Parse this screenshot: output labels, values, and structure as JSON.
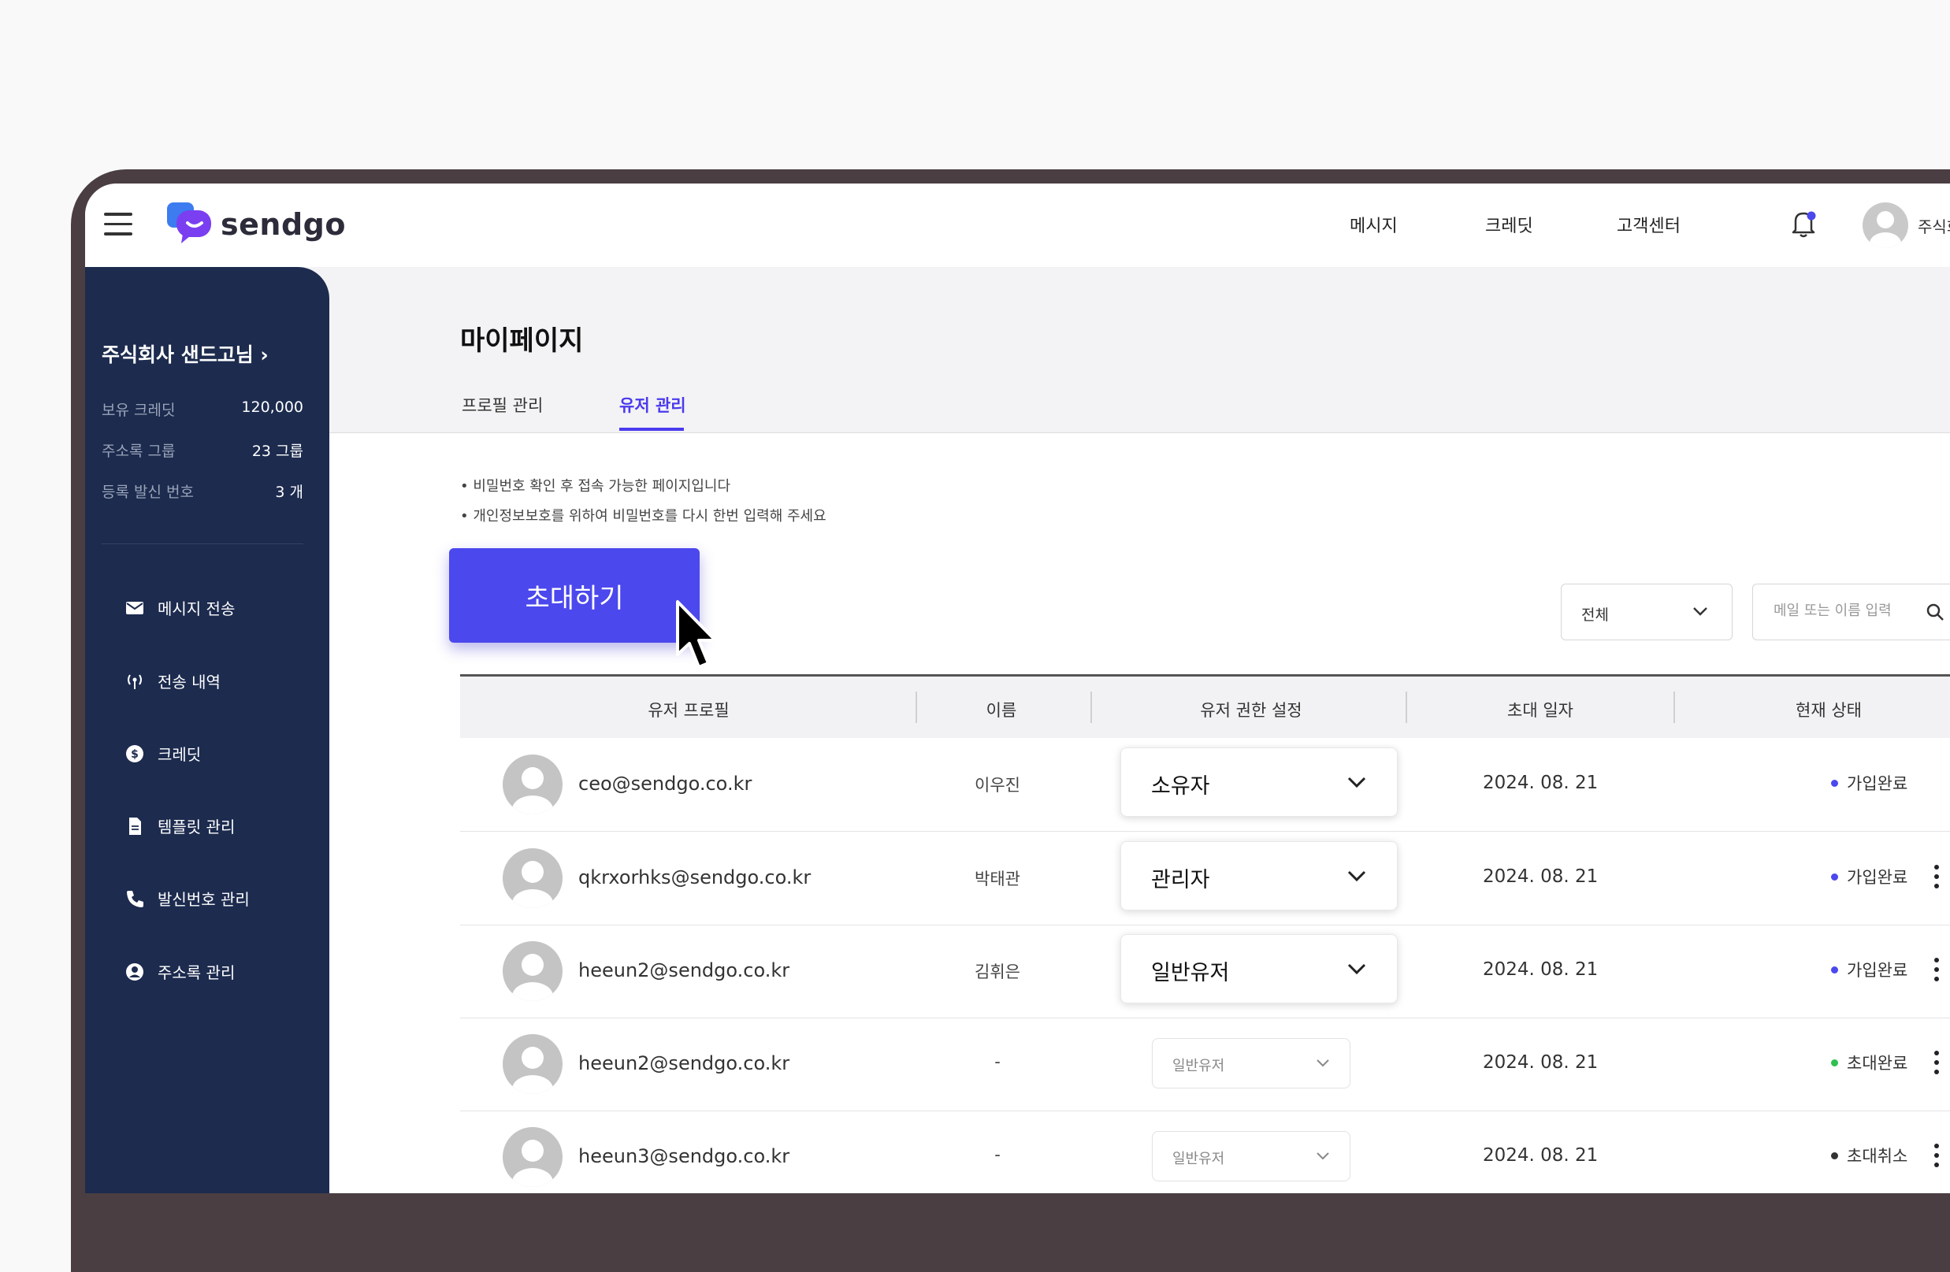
{
  "header": {
    "logo_text": "sendgo",
    "nav": [
      "메시지",
      "크레딧",
      "고객센터"
    ],
    "user_name_partial": "주식회"
  },
  "sidebar": {
    "company": "주식회사 샌드고님 ›",
    "stats": [
      {
        "label": "보유 크레딧",
        "value": "120,000"
      },
      {
        "label": "주소록 그룹",
        "value": "23 그룹"
      },
      {
        "label": "등록 발신 번호",
        "value": "3 개"
      }
    ],
    "menu": [
      {
        "label": "메시지 전송",
        "icon": "mail-icon"
      },
      {
        "label": "전송 내역",
        "icon": "broadcast-icon"
      },
      {
        "label": "크레딧",
        "icon": "dollar-icon"
      },
      {
        "label": "템플릿 관리",
        "icon": "document-icon"
      },
      {
        "label": "발신번호 관리",
        "icon": "phone-icon"
      },
      {
        "label": "주소록 관리",
        "icon": "user-circle-icon"
      }
    ]
  },
  "page": {
    "title": "마이페이지",
    "tabs": [
      "프로필 관리",
      "유저 관리"
    ],
    "active_tab": "유저 관리",
    "notes": [
      "• 비밀번호 확인 후 접속 가능한 페이지입니다",
      "• 개인정보보호를 위하여 비밀번호를 다시 한번 입력해 주세요"
    ],
    "invite_button": "초대하기",
    "filter": {
      "selected": "전체"
    },
    "search": {
      "placeholder": "메일 또는 이름 입력"
    }
  },
  "table": {
    "columns": [
      "유저 프로필",
      "이름",
      "유저 권한 설정",
      "초대 일자",
      "현재 상태"
    ],
    "rows": [
      {
        "email": "ceo@sendgo.co.kr",
        "name": "이우진",
        "role": "소유자",
        "date": "2024. 08. 21",
        "status": "가입완료",
        "status_color": "#4b48ed"
      },
      {
        "email": "qkrxorhks@sendgo.co.kr",
        "name": "박태관",
        "role": "관리자",
        "date": "2024. 08. 21",
        "status": "가입완료",
        "status_color": "#4b48ed"
      },
      {
        "email": "heeun2@sendgo.co.kr",
        "name": "김휘은",
        "role": "일반유저",
        "date": "2024. 08. 21",
        "status": "가입완료",
        "status_color": "#4b48ed"
      },
      {
        "email": "heeun2@sendgo.co.kr",
        "name": "-",
        "role": "일반유저",
        "date": "2024. 08. 21",
        "status": "초대완료",
        "status_color": "#2fbf52"
      },
      {
        "email": "heeun3@sendgo.co.kr",
        "name": "-",
        "role": "일반유저",
        "date": "2024. 08. 21",
        "status": "초대취소",
        "status_color": "#333333"
      }
    ]
  },
  "colors": {
    "accent": "#4b48ed",
    "sidebar": "#1c2b4e"
  }
}
